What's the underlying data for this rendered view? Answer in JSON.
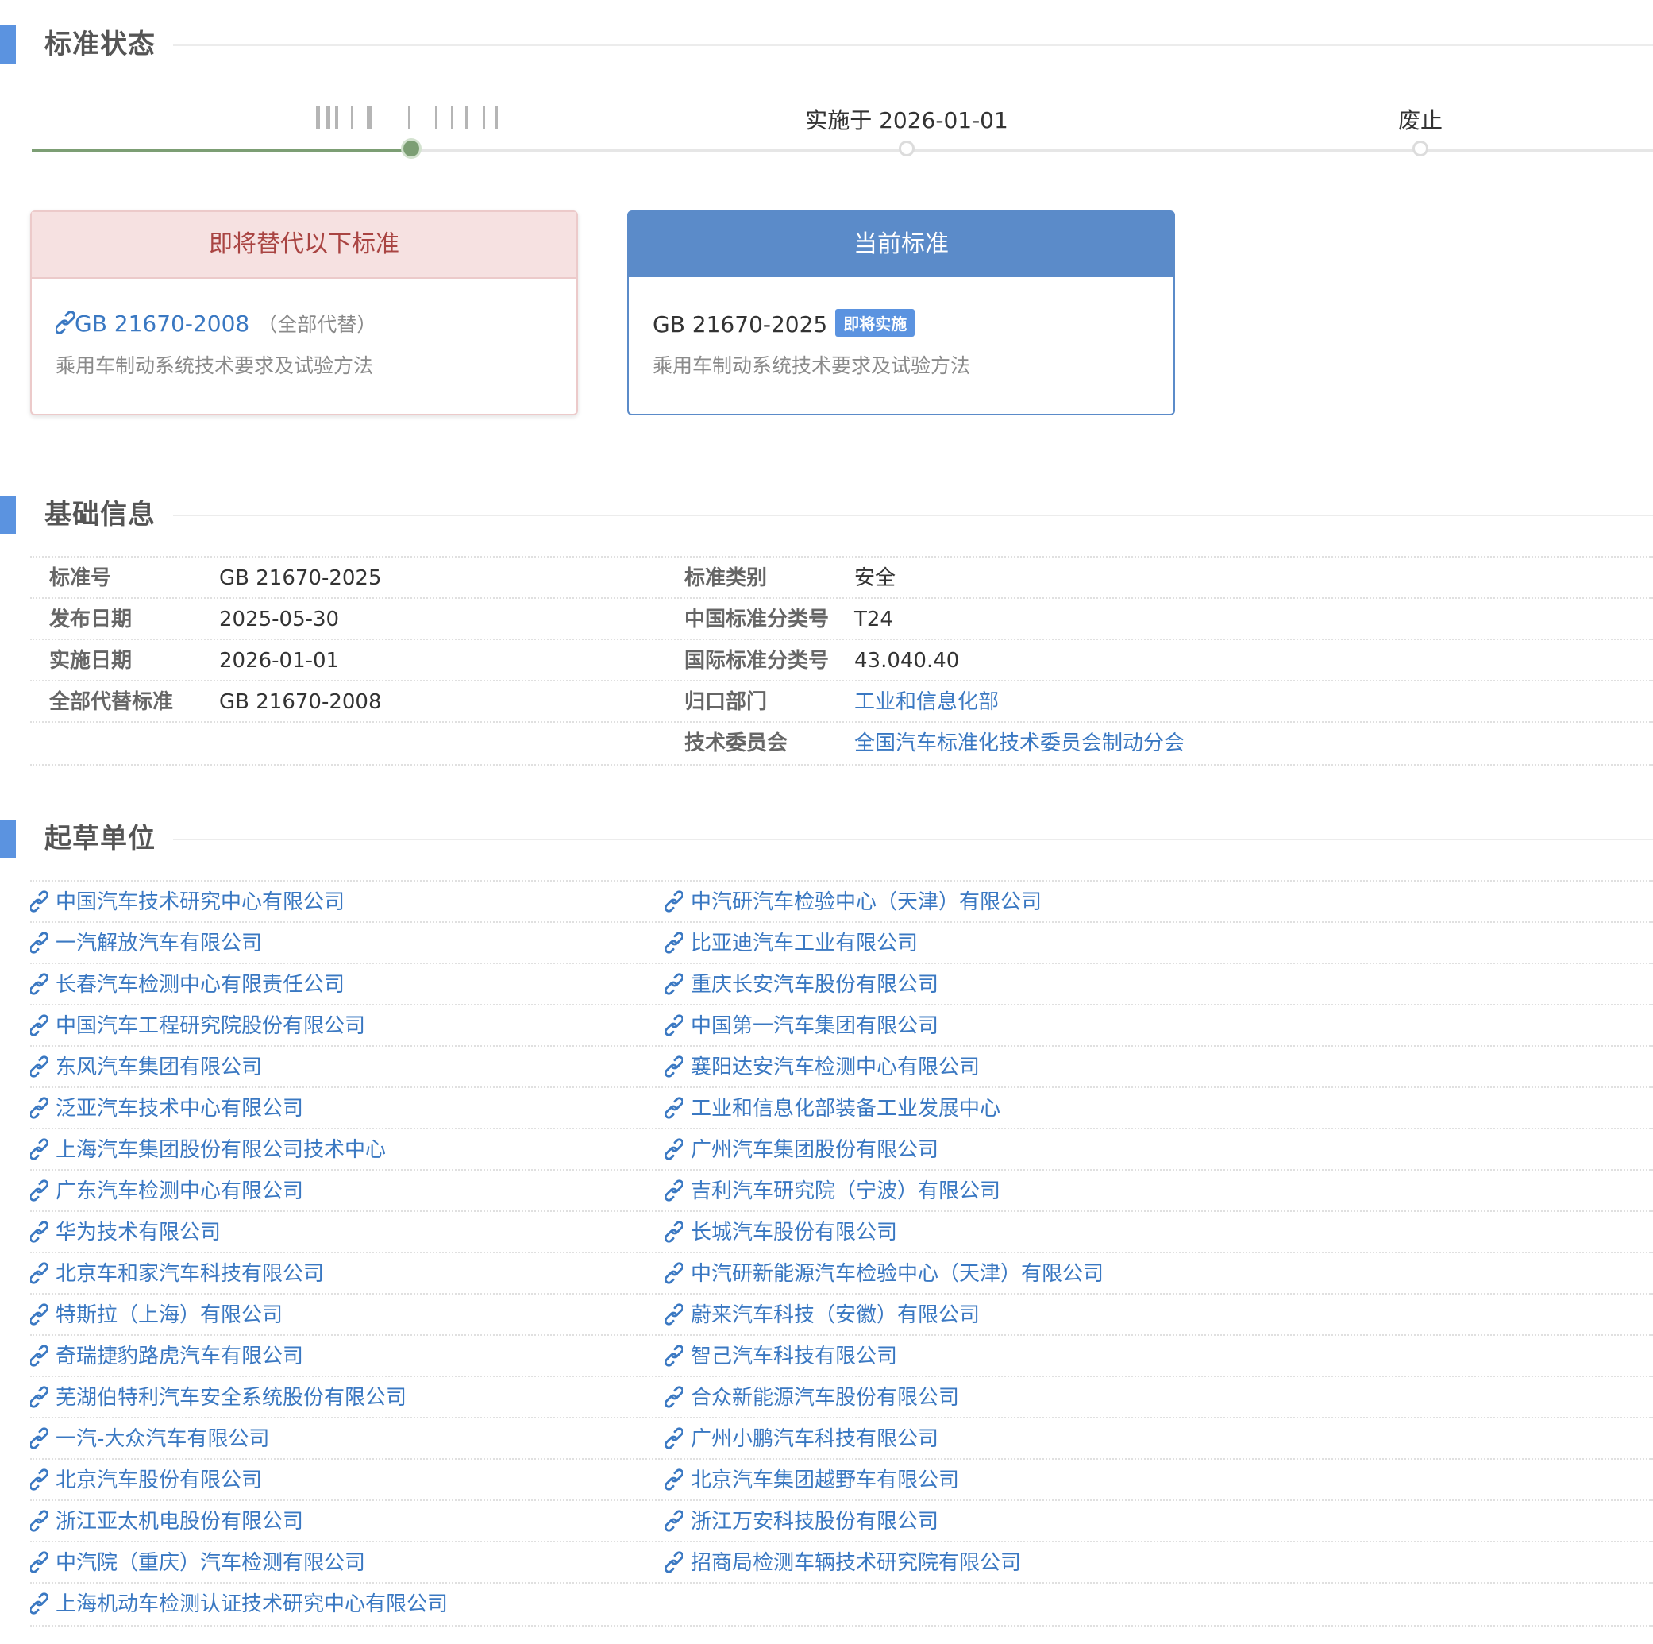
{
  "sections": {
    "status": "标准状态",
    "basic": "基础信息",
    "drafters": "起草单位"
  },
  "timeline": {
    "stage2": "实施于 2026-01-01",
    "stage3": "废止"
  },
  "replaced_card": {
    "header": "即将替代以下标准",
    "code": "GB 21670-2008",
    "note": "（全部代替）",
    "desc": "乘用车制动系统技术要求及试验方法"
  },
  "current_card": {
    "header": "当前标准",
    "code": "GB 21670-2025",
    "badge": "即将实施",
    "desc": "乘用车制动系统技术要求及试验方法"
  },
  "info": {
    "rows": [
      {
        "l1": "标准号",
        "v1": "GB 21670-2025",
        "l2": "标准类别",
        "v2": "安全"
      },
      {
        "l1": "发布日期",
        "v1": "2025-05-30",
        "l2": "中国标准分类号",
        "v2": "T24"
      },
      {
        "l1": "实施日期",
        "v1": "2026-01-01",
        "l2": "国际标准分类号",
        "v2": "43.040.40"
      },
      {
        "l1": "全部代替标准",
        "v1": "GB 21670-2008",
        "l2": "归口部门",
        "v2": "工业和信息化部"
      },
      {
        "l1": "",
        "v1": "",
        "l2": "技术委员会",
        "v2": "全国汽车标准化技术委员会制动分会"
      }
    ]
  },
  "drafters": {
    "left": [
      "中国汽车技术研究中心有限公司",
      "一汽解放汽车有限公司",
      "长春汽车检测中心有限责任公司",
      "中国汽车工程研究院股份有限公司",
      "东风汽车集团有限公司",
      "泛亚汽车技术中心有限公司",
      "上海汽车集团股份有限公司技术中心",
      "广东汽车检测中心有限公司",
      "华为技术有限公司",
      "北京车和家汽车科技有限公司",
      "特斯拉（上海）有限公司",
      "奇瑞捷豹路虎汽车有限公司",
      "芜湖伯特利汽车安全系统股份有限公司",
      "一汽-大众汽车有限公司",
      "北京汽车股份有限公司",
      "浙江亚太机电股份有限公司",
      "中汽院（重庆）汽车检测有限公司",
      "上海机动车检测认证技术研究中心有限公司"
    ],
    "right": [
      "中汽研汽车检验中心（天津）有限公司",
      "比亚迪汽车工业有限公司",
      "重庆长安汽车股份有限公司",
      "中国第一汽车集团有限公司",
      "襄阳达安汽车检测中心有限公司",
      "工业和信息化部装备工业发展中心",
      "广州汽车集团股份有限公司",
      "吉利汽车研究院（宁波）有限公司",
      "长城汽车股份有限公司",
      "中汽研新能源汽车检验中心（天津）有限公司",
      "蔚来汽车科技（安徽）有限公司",
      "智己汽车科技有限公司",
      "合众新能源汽车股份有限公司",
      "广州小鹏汽车科技有限公司",
      "北京汽车集团越野车有限公司",
      "浙江万安科技股份有限公司",
      "招商局检测车辆技术研究院有限公司"
    ]
  },
  "icons": {
    "link": "link-icon"
  },
  "colors": {
    "accent": "#5b93e0",
    "link": "#3a78c2",
    "progress": "#7c9e74",
    "replaced_header_bg": "#f6e1e1",
    "replaced_header_text": "#a94442",
    "current_header_bg": "#5b8bc9"
  }
}
